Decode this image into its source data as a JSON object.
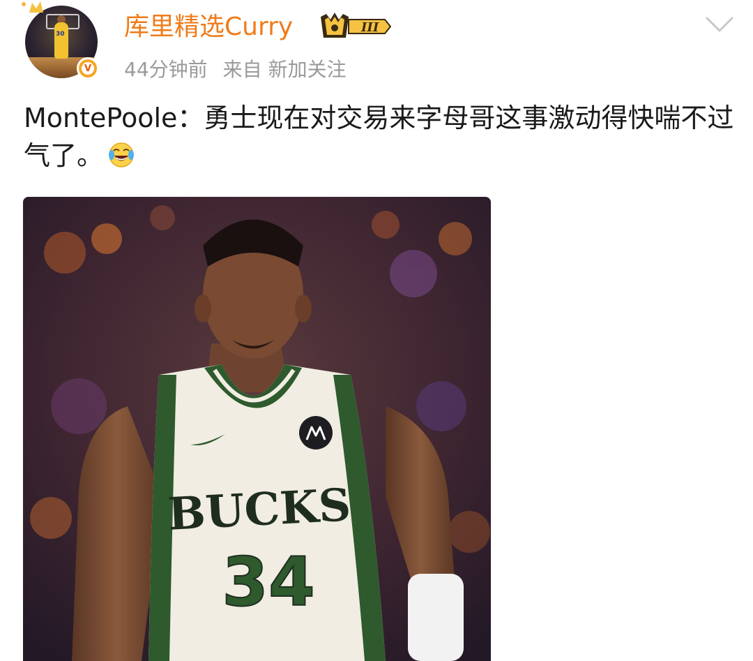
{
  "post": {
    "author_name": "库里精选Curry",
    "time": "44分钟前",
    "source_prefix": "来自",
    "source": "新加关注",
    "text": "MontePoole：勇士现在对交易来字母哥这事激动得快喘不过气了。",
    "emoji": "laughing-crying-emoji"
  },
  "avatar": {
    "jersey_number": "30"
  },
  "badges": {
    "level": "III",
    "verified": "V"
  },
  "image": {
    "jersey_team": "BUCKS",
    "jersey_number": "34"
  },
  "colors": {
    "name": "#f07b1a",
    "meta": "#9a9a9a",
    "text": "#1a1a1a",
    "verified": "#f5a623",
    "jersey_green": "#2e5a2e",
    "jersey_cream": "#f1ede2"
  }
}
